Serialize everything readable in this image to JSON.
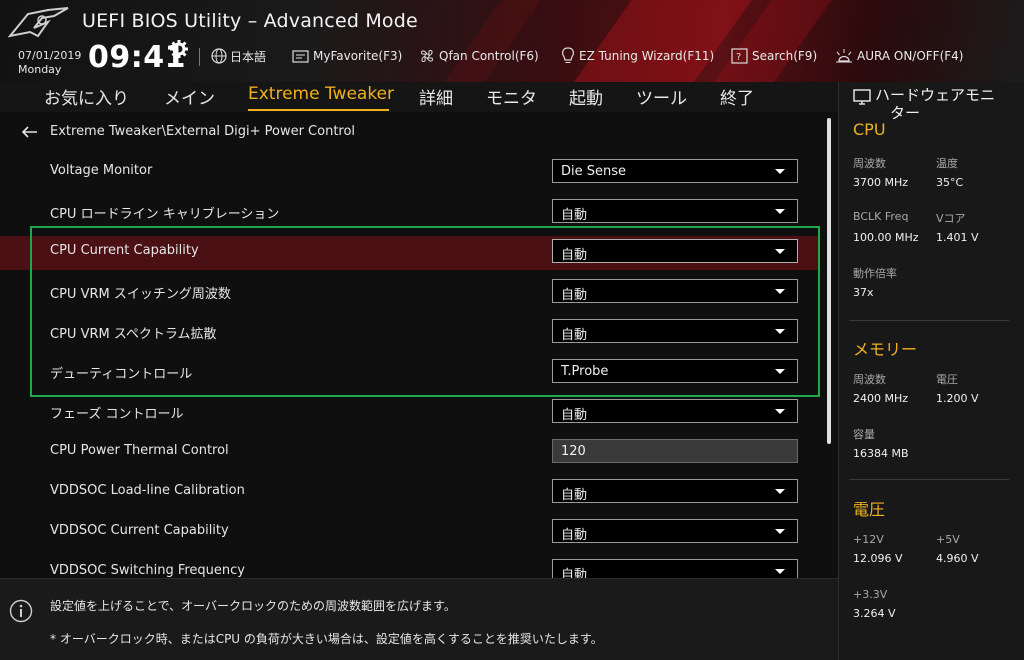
{
  "header": {
    "title": "UEFI BIOS Utility – Advanced Mode",
    "date": "07/01/2019",
    "weekday": "Monday",
    "time": "09:41",
    "toolbar": {
      "language": "日本語",
      "favorite": "MyFavorite(F3)",
      "qfan": "Qfan Control(F6)",
      "ez_tuning": "EZ Tuning Wizard(F11)",
      "search": "Search(F9)",
      "aura": "AURA ON/OFF(F4)"
    }
  },
  "menu": {
    "tabs": [
      "お気に入り",
      "メイン",
      "Extreme Tweaker",
      "詳細",
      "モニタ",
      "起動",
      "ツール",
      "終了"
    ],
    "active_index": 2
  },
  "breadcrumb": "Extreme Tweaker\\External Digi+ Power Control",
  "settings": [
    {
      "label": "Voltage Monitor",
      "value": "Die Sense",
      "type": "select"
    },
    {
      "label": "CPU ロードライン キャリブレーション",
      "value": "自動",
      "type": "select"
    },
    {
      "label": "CPU Current Capability",
      "value": "自動",
      "type": "select"
    },
    {
      "label": "CPU VRM スイッチング周波数",
      "value": "自動",
      "type": "select"
    },
    {
      "label": "CPU VRM スペクトラム拡散",
      "value": "自動",
      "type": "select"
    },
    {
      "label": "デューティコントロール",
      "value": "T.Probe",
      "type": "select"
    },
    {
      "label": "フェーズ コントロール",
      "value": "自動",
      "type": "select"
    },
    {
      "label": "CPU Power Thermal Control",
      "value": "120",
      "type": "number"
    },
    {
      "label": "VDDSOC Load-line Calibration",
      "value": "自動",
      "type": "select"
    },
    {
      "label": "VDDSOC Current Capability",
      "value": "自動",
      "type": "select"
    },
    {
      "label": "VDDSOC Switching Frequency",
      "value": "自動",
      "type": "select"
    }
  ],
  "selected_row": 2,
  "info": {
    "line1": "設定値を上げることで、オーバークロックのための周波数範囲を広げます。",
    "line2": "* オーバークロック時、またはCPU の負荷が大きい場合は、設定値を高くすることを推奨いたします。"
  },
  "hw_monitor": {
    "title_line1": "ハードウェアモニ",
    "title_line2": "ター",
    "cpu": {
      "section": "CPU",
      "freq_label": "周波数",
      "freq_value": "3700 MHz",
      "temp_label": "温度",
      "temp_value": "35°C",
      "bclk_label": "BCLK Freq",
      "bclk_value": "100.00 MHz",
      "vcore_label": "Vコア",
      "vcore_value": "1.401 V",
      "ratio_label": "動作倍率",
      "ratio_value": "37x"
    },
    "memory": {
      "section": "メモリー",
      "freq_label": "周波数",
      "freq_value": "2400 MHz",
      "volt_label": "電圧",
      "volt_value": "1.200 V",
      "cap_label": "容量",
      "cap_value": "16384 MB"
    },
    "voltage": {
      "section": "電圧",
      "v12_label": "+12V",
      "v12_value": "12.096 V",
      "v5_label": "+5V",
      "v5_value": "4.960 V",
      "v33_label": "+3.3V",
      "v33_value": "3.264 V"
    }
  },
  "colors": {
    "accent": "#f0b020",
    "highlight": "#4a1014",
    "frame": "#1fa84a"
  }
}
